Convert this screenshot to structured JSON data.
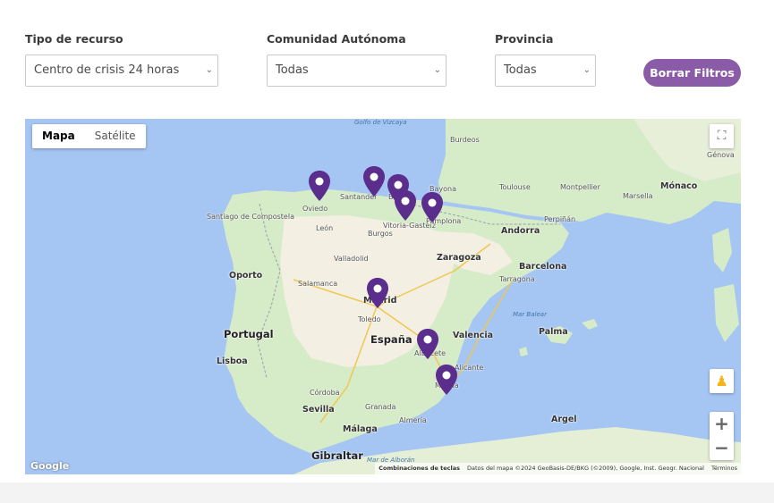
{
  "filters": {
    "recurso": {
      "label": "Tipo de recurso",
      "value": "Centro de crisis 24 horas"
    },
    "comunidad": {
      "label": "Comunidad Autónoma",
      "value": "Todas"
    },
    "provincia": {
      "label": "Provincia",
      "value": "Todas"
    },
    "clear_label": "Borrar Filtros"
  },
  "colors": {
    "accent": "#8a5ba6",
    "marker": "#5b2d8c",
    "sea": "#a5c5f2",
    "land": "#d6ebc7",
    "plateau": "#f3efe2"
  },
  "map": {
    "type_map": "Mapa",
    "type_satellite": "Satélite",
    "zoom_in": "+",
    "zoom_out": "−",
    "google": "Google",
    "attribution": {
      "shortcuts": "Combinaciones de teclas",
      "data": "Datos del mapa ©2024 GeoBasis-DE/BKG (©2009), Google, Inst. Geogr. Nacional",
      "terms": "Términos"
    },
    "places": {
      "espana": "España",
      "portugal": "Portugal",
      "andorra": "Andorra",
      "monaco": "Mónaco",
      "madrid": "Madrid",
      "zaragoza": "Zaragoza",
      "barcelona": "Barcelona",
      "valencia": "Valencia",
      "sevilla": "Sevilla",
      "malaga": "Málaga",
      "gibraltar": "Gibraltar",
      "lisboa": "Lisboa",
      "oporto": "Oporto",
      "santiago": "Santiago de Compostela",
      "oviedo": "Oviedo",
      "santander": "Santander",
      "bilbao": "Bilbao",
      "vitoria": "Vitoria-Gasteiz",
      "bayona": "Bayona",
      "burgos": "Burgos",
      "valladolid": "Valladolid",
      "salamanca": "Salamanca",
      "toledo": "Toledo",
      "cordoba": "Córdoba",
      "granada": "Granada",
      "almeria": "Almería",
      "murcia": "Murcia",
      "albacete": "Albacete",
      "alicante": "Alicante",
      "palma": "Palma",
      "argel": "Argel",
      "toulouse": "Toulouse",
      "montpellier": "Montpellier",
      "marsella": "Marsella",
      "burdeos": "Burdeos",
      "genova": "Génova",
      "perpinan": "Perpiñán",
      "tarragona": "Tarragona",
      "pamplona": "Pamplona",
      "leon": "León",
      "golfo": "Golfo de Vizcaya",
      "mar_balear": "Mar Balear",
      "mar_alboran": "Mar de Alborán"
    }
  }
}
